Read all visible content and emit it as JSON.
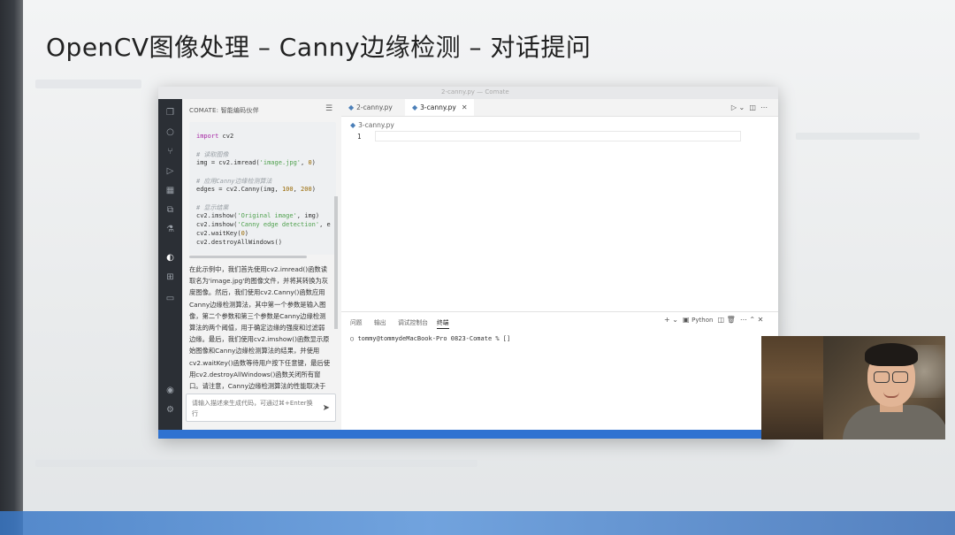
{
  "slide": {
    "title": "OpenCV图像处理 – Canny边缘检测 – 对话提问"
  },
  "window": {
    "title": "2-canny.py — Comate"
  },
  "sidebar": {
    "header": "COMATE: 智能编码伙伴",
    "menu_icon": "menu-lines-icon",
    "code": {
      "l1_kw": "import",
      "l1_rest": " cv2",
      "l2_cm": "# 读取图像",
      "l3_pre": "img = cv2.imread(",
      "l3_str": "'image.jpg'",
      "l3_mid": ", ",
      "l3_num": "0",
      "l3_end": ")",
      "l4_cm": "# 应用Canny边缘检测算法",
      "l5_pre": "edges = cv2.Canny(img, ",
      "l5_num1": "100",
      "l5_mid": ", ",
      "l5_num2": "200",
      "l5_end": ")",
      "l6_cm": "# 显示结果",
      "l7_pre": "cv2.imshow(",
      "l7_str": "'Original image'",
      "l7_end": ", img)",
      "l8_pre": "cv2.imshow(",
      "l8_str": "'Canny edge detection'",
      "l8_end": ", e",
      "l9_pre": "cv2.waitKey(",
      "l9_num": "0",
      "l9_end": ")",
      "l10": "cv2.destroyAllWindows()"
    },
    "explanation": "在此示例中，我们首先使用cv2.imread()函数读取名为'image.jpg'的图像文件，并将其转换为灰度图像。然后，我们使用cv2.Canny()函数应用Canny边缘检测算法，其中第一个参数是输入图像，第二个参数和第三个参数是Canny边缘检测算法的两个阈值，用于确定边缘的强度和过滤弱边缘。最后，我们使用cv2.imshow()函数显示原始图像和Canny边缘检测算法的结果，并使用cv2.waitKey()函数等待用户按下任意键，最后使用cv2.destroyAllWindows()函数关闭所有窗口。请注意，Canny边缘检测算法的性能取决于两个阈值的选择。通常，阈值的选择取决于应用程序的需求。例如，对于低分辨率的图",
    "input_placeholder": "请输入描述来生成代码，可通过⌘+Enter换行"
  },
  "editor": {
    "tabs": [
      {
        "label": "2-canny.py"
      },
      {
        "label": "3-canny.py"
      }
    ],
    "breadcrumb": "3-canny.py",
    "line_number": "1"
  },
  "panel": {
    "tabs": [
      "问题",
      "输出",
      "调试控制台",
      "终端"
    ],
    "language": "Python",
    "terminal_prompt": "tommy@tommydeMacBook-Pro 0823-Comate % []"
  }
}
